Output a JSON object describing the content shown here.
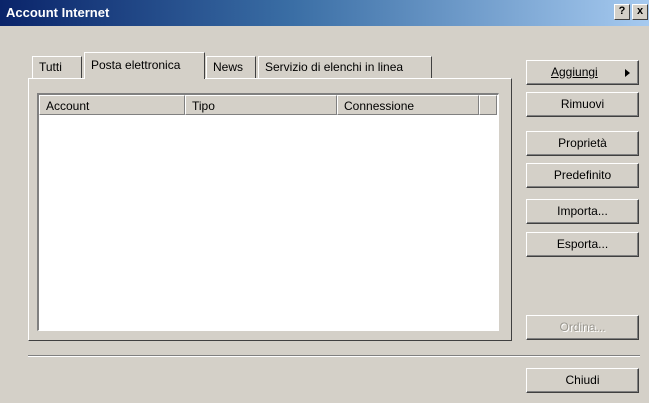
{
  "window": {
    "title": "Account Internet",
    "help_label": "?",
    "close_label": "x"
  },
  "tabs": [
    {
      "label": "Tutti"
    },
    {
      "label": "Posta elettronica",
      "active": true
    },
    {
      "label": "News"
    },
    {
      "label": "Servizio di elenchi in linea"
    }
  ],
  "list": {
    "columns": [
      "Account",
      "Tipo",
      "Connessione",
      ""
    ],
    "rows": []
  },
  "buttons": {
    "aggiungi": "Aggiungi",
    "rimuovi": "Rimuovi",
    "proprieta": "Proprietà",
    "predefinito": "Predefinito",
    "importa": "Importa...",
    "esporta": "Esporta...",
    "ordina": "Ordina...",
    "chiudi": "Chiudi"
  }
}
